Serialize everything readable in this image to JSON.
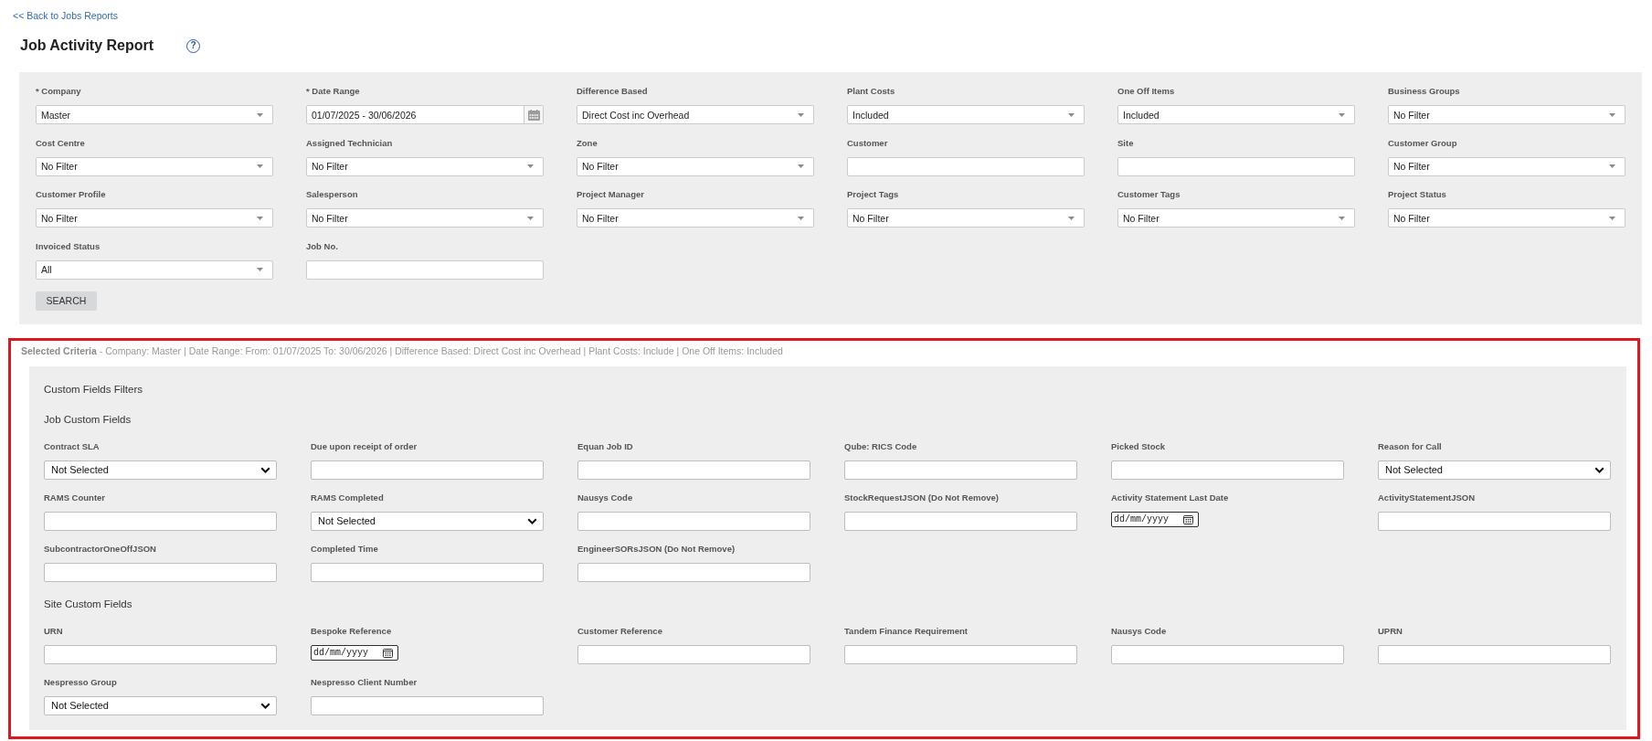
{
  "back_link": "<< Back to Jobs Reports",
  "title": "Job Activity Report",
  "help_button": "?",
  "filters": [
    {
      "label": "* Company",
      "kind": "select",
      "value": "Master"
    },
    {
      "label": "* Date Range",
      "kind": "date_range",
      "value": "01/07/2025 - 30/06/2026"
    },
    {
      "label": "Difference Based",
      "kind": "select",
      "value": "Direct Cost inc Overhead"
    },
    {
      "label": "Plant Costs",
      "kind": "select",
      "value": "Included"
    },
    {
      "label": "One Off Items",
      "kind": "select",
      "value": "Included"
    },
    {
      "label": "Business Groups",
      "kind": "select",
      "value": "No Filter"
    },
    {
      "label": "Cost Centre",
      "kind": "select",
      "value": "No Filter"
    },
    {
      "label": "Assigned Technician",
      "kind": "select",
      "value": "No Filter"
    },
    {
      "label": "Zone",
      "kind": "select",
      "value": "No Filter"
    },
    {
      "label": "Customer",
      "kind": "text"
    },
    {
      "label": "Site",
      "kind": "text"
    },
    {
      "label": "Customer Group",
      "kind": "select",
      "value": "No Filter"
    },
    {
      "label": "Customer Profile",
      "kind": "select",
      "value": "No Filter"
    },
    {
      "label": "Salesperson",
      "kind": "select",
      "value": "No Filter"
    },
    {
      "label": "Project Manager",
      "kind": "select",
      "value": "No Filter"
    },
    {
      "label": "Project Tags",
      "kind": "select",
      "value": "No Filter"
    },
    {
      "label": "Customer Tags",
      "kind": "select",
      "value": "No Filter"
    },
    {
      "label": "Project Status",
      "kind": "select",
      "value": "No Filter"
    },
    {
      "label": "Invoiced Status",
      "kind": "select",
      "value": "All"
    },
    {
      "label": "Job No.",
      "kind": "text"
    }
  ],
  "search_button": "SEARCH",
  "selected_criteria": "**Selected Criteria** - Company: Master | Date Range: From: 01/07/2025 To: 30/06/2026 | Difference Based: Direct Cost inc Overhead | Plant Costs: Include | One Off Items: Included",
  "custom_fields": {
    "title": "Custom Fields Filters",
    "sections": [
      {
        "title": "Job Custom Fields",
        "fields": [
          {
            "label": "Contract SLA",
            "kind": "select",
            "value": "Not Selected"
          },
          {
            "label": "Due upon receipt of order",
            "kind": "text"
          },
          {
            "label": "Equan Job ID",
            "kind": "text"
          },
          {
            "label": "Qube: RICS Code",
            "kind": "text"
          },
          {
            "label": "Picked Stock",
            "kind": "text"
          },
          {
            "label": "Reason for Call",
            "kind": "select",
            "value": "Not Selected"
          },
          {
            "label": "RAMS Counter",
            "kind": "text"
          },
          {
            "label": "RAMS Completed",
            "kind": "select",
            "value": "Not Selected"
          },
          {
            "label": "Nausys Code",
            "kind": "text"
          },
          {
            "label": "StockRequestJSON (Do Not Remove)",
            "kind": "text"
          },
          {
            "label": "Activity Statement Last Date",
            "kind": "date",
            "placeholder": "dd/mm/yyyy"
          },
          {
            "label": "ActivityStatementJSON",
            "kind": "text"
          },
          {
            "label": "SubcontractorOneOffJSON",
            "kind": "text"
          },
          {
            "label": "Completed Time",
            "kind": "text"
          },
          {
            "label": "EngineerSORsJSON (Do Not Remove)",
            "kind": "text"
          }
        ]
      },
      {
        "title": "Site Custom Fields",
        "fields": [
          {
            "label": "URN",
            "kind": "text"
          },
          {
            "label": "Bespoke Reference",
            "kind": "date",
            "placeholder": "dd/mm/yyyy"
          },
          {
            "label": "Customer Reference",
            "kind": "text"
          },
          {
            "label": "Tandem Finance Requirement",
            "kind": "text"
          },
          {
            "label": "Nausys Code",
            "kind": "text"
          },
          {
            "label": "UPRN",
            "kind": "text"
          },
          {
            "label": "Nespresso Group",
            "kind": "select",
            "value": "Not Selected"
          },
          {
            "label": "Nespresso Client Number",
            "kind": "text"
          }
        ]
      }
    ]
  }
}
